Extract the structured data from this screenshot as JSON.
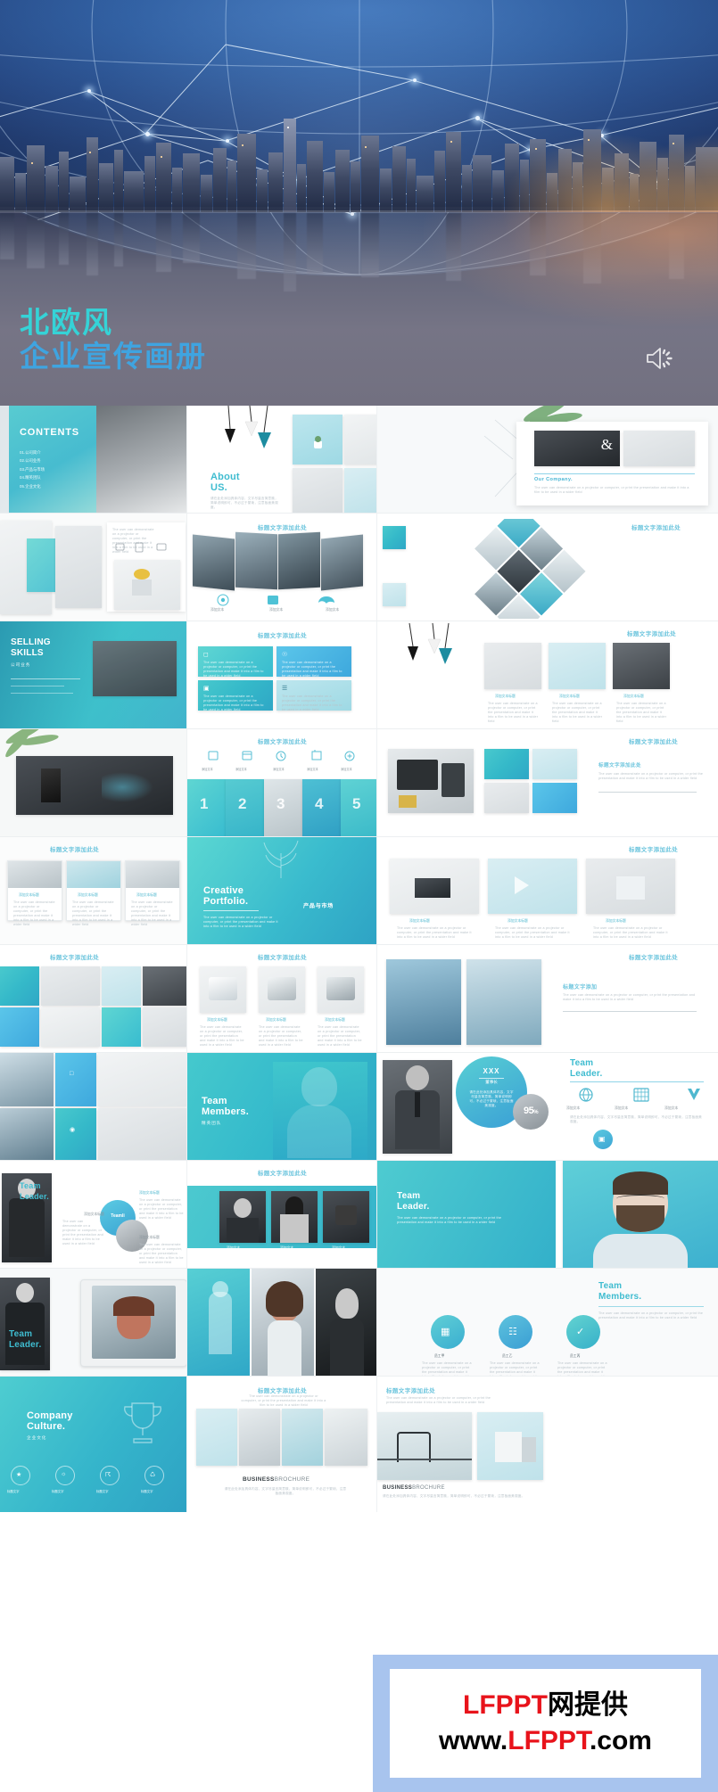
{
  "hero": {
    "title_line1": "北欧风",
    "title_line2": "企业宣传画册",
    "speaker_icon": "speaker-icon",
    "accent_teal": "#35d3d7",
    "accent_blue": "#3fa4e0"
  },
  "watermark": {
    "line1_red": "LFPPT",
    "line1_black": "网提供",
    "line2_www": "www.",
    "line2_red": "LFPPT",
    "line2_tld": ".com",
    "border_color": "#a8c4ee"
  },
  "common": {
    "slide_title": "标题文字添加此处",
    "slide_title_short": "标题文字添加此",
    "lorem_en": "The user can demonstrate on a projector or computer, or print the presentation and make it into a film to be used in a wider field",
    "lorem_cn": "请在此处添加具体内容，文字尽量言简意赅，简单说明即可，不必过于繁琐，注意板面美观度。",
    "add_text": "添加文本",
    "add_title": "添加文本标题",
    "subtitle_cn": "标题文字添加"
  },
  "slides": {
    "contents": {
      "heading": "CONTENTS",
      "items": [
        "01.公司简介",
        "02.公司业务",
        "03.产品与市场",
        "04.精英团队",
        "05.企业文化"
      ]
    },
    "about": {
      "line1": "About",
      "line2": "US."
    },
    "our_company": {
      "title": "Our Company.",
      "mark": "&"
    },
    "selling": {
      "line1": "SELLING",
      "line2": "SKILLS",
      "cn": "公司业务"
    },
    "creative": {
      "line1": "Creative",
      "line2": "Portfolio.",
      "tag": "产品与市场"
    },
    "numbers": {
      "items": [
        "1",
        "2",
        "3",
        "4",
        "5"
      ]
    },
    "team_members": {
      "line1": "Team",
      "line2": "Members.",
      "cn": "精英团队"
    },
    "team_leader": {
      "line1": "Team",
      "line2": "Leader."
    },
    "leader_card": {
      "name": "XXX",
      "role": "董事长",
      "stat": "95",
      "stat_unit": "%"
    },
    "company_culture": {
      "line1": "Company",
      "line2": "Culture.",
      "cn": "企业文化"
    },
    "brochure": {
      "bold": "BUSINESS",
      "light": "BROCHURE"
    },
    "icon_labels": [
      "添加文本",
      "添加文本",
      "添加文本",
      "添加文本",
      "添加文本"
    ],
    "card_labels": [
      "添加文本标题",
      "添加文本标题",
      "添加文本标题"
    ],
    "culture_labels": [
      "标题文字",
      "标题文字",
      "标题文字",
      "标题文字"
    ],
    "member_labels": [
      "员工甲",
      "员工乙",
      "员工丙"
    ]
  }
}
